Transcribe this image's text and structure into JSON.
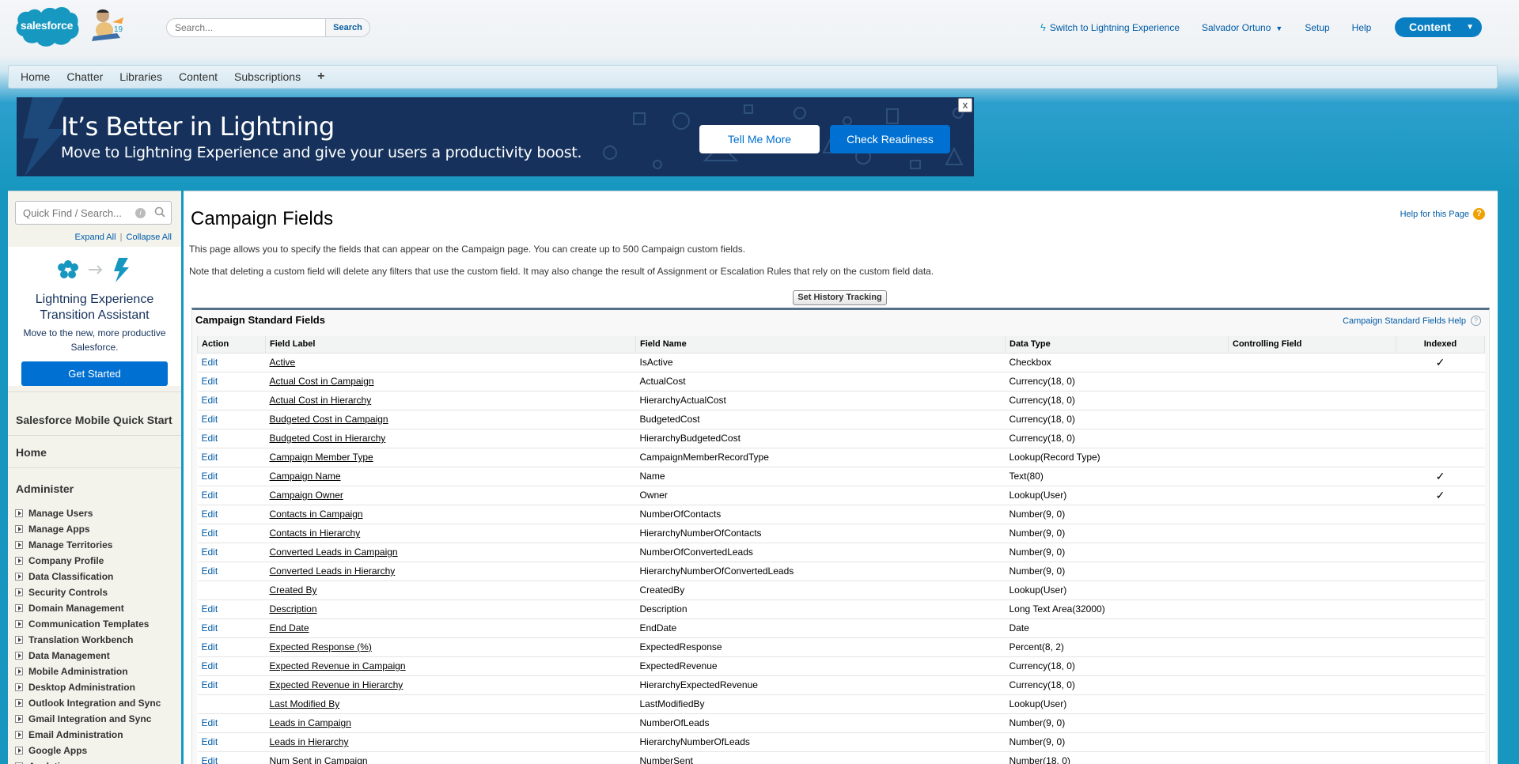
{
  "header": {
    "logo_text": "salesforce",
    "mascot_badge": "19",
    "search_placeholder": "Search...",
    "search_button": "Search",
    "switch_link": "Switch to Lightning Experience",
    "user_name": "Salvador Ortuno",
    "setup": "Setup",
    "help": "Help",
    "app_menu": "Content"
  },
  "tabs": [
    "Home",
    "Chatter",
    "Libraries",
    "Content",
    "Subscriptions"
  ],
  "tabs_plus": "+",
  "banner": {
    "title": "It’s Better in Lightning",
    "subtitle": "Move to Lightning Experience and give your users a productivity boost.",
    "tell_me_more": "Tell Me More",
    "check_readiness": "Check Readiness",
    "close": "x"
  },
  "sidebar": {
    "quick_find_placeholder": "Quick Find / Search...",
    "expand_all": "Expand All",
    "separator": "|",
    "collapse_all": "Collapse All",
    "lea_title": "Lightning Experience Transition Assistant",
    "lea_subtitle": "Move to the new, more productive Salesforce.",
    "lea_button": "Get Started",
    "mobile_quick_start": "Salesforce Mobile Quick Start",
    "home": "Home",
    "administer": "Administer",
    "items": [
      "Manage Users",
      "Manage Apps",
      "Manage Territories",
      "Company Profile",
      "Data Classification",
      "Security Controls",
      "Domain Management",
      "Communication Templates",
      "Translation Workbench",
      "Data Management",
      "Mobile Administration",
      "Desktop Administration",
      "Outlook Integration and Sync",
      "Gmail Integration and Sync",
      "Email Administration",
      "Google Apps",
      "Analytics"
    ]
  },
  "main": {
    "title": "Campaign Fields",
    "help_for_page": "Help for this Page",
    "description_1": "This page allows you to specify the fields that can appear on the Campaign page. You can create up to 500 Campaign custom fields.",
    "description_2": "Note that deleting a custom field will delete any filters that use the custom field. It may also change the result of Assignment or Escalation Rules that rely on the custom field data.",
    "history_button": "Set History Tracking",
    "panel_title": "Campaign Standard Fields",
    "panel_help": "Campaign Standard Fields Help",
    "columns": [
      "Action",
      "Field Label",
      "Field Name",
      "Data Type",
      "Controlling Field",
      "Indexed"
    ],
    "rows": [
      {
        "action": "Edit",
        "label": "Active",
        "name": "IsActive",
        "type": "Checkbox",
        "controlling": "",
        "indexed": "✓"
      },
      {
        "action": "Edit",
        "label": "Actual Cost in Campaign",
        "name": "ActualCost",
        "type": "Currency(18, 0)",
        "controlling": "",
        "indexed": ""
      },
      {
        "action": "Edit",
        "label": "Actual Cost in Hierarchy",
        "name": "HierarchyActualCost",
        "type": "Currency(18, 0)",
        "controlling": "",
        "indexed": ""
      },
      {
        "action": "Edit",
        "label": "Budgeted Cost in Campaign",
        "name": "BudgetedCost",
        "type": "Currency(18, 0)",
        "controlling": "",
        "indexed": ""
      },
      {
        "action": "Edit",
        "label": "Budgeted Cost in Hierarchy",
        "name": "HierarchyBudgetedCost",
        "type": "Currency(18, 0)",
        "controlling": "",
        "indexed": ""
      },
      {
        "action": "Edit",
        "label": "Campaign Member Type",
        "name": "CampaignMemberRecordType",
        "type": "Lookup(Record Type)",
        "controlling": "",
        "indexed": ""
      },
      {
        "action": "Edit",
        "label": "Campaign Name",
        "name": "Name",
        "type": "Text(80)",
        "controlling": "",
        "indexed": "✓"
      },
      {
        "action": "Edit",
        "label": "Campaign Owner",
        "name": "Owner",
        "type": "Lookup(User)",
        "controlling": "",
        "indexed": "✓"
      },
      {
        "action": "Edit",
        "label": "Contacts in Campaign",
        "name": "NumberOfContacts",
        "type": "Number(9, 0)",
        "controlling": "",
        "indexed": ""
      },
      {
        "action": "Edit",
        "label": "Contacts in Hierarchy",
        "name": "HierarchyNumberOfContacts",
        "type": "Number(9, 0)",
        "controlling": "",
        "indexed": ""
      },
      {
        "action": "Edit",
        "label": "Converted Leads in Campaign",
        "name": "NumberOfConvertedLeads",
        "type": "Number(9, 0)",
        "controlling": "",
        "indexed": ""
      },
      {
        "action": "Edit",
        "label": "Converted Leads in Hierarchy",
        "name": "HierarchyNumberOfConvertedLeads",
        "type": "Number(9, 0)",
        "controlling": "",
        "indexed": ""
      },
      {
        "action": "",
        "label": "Created By",
        "name": "CreatedBy",
        "type": "Lookup(User)",
        "controlling": "",
        "indexed": ""
      },
      {
        "action": "Edit",
        "label": "Description",
        "name": "Description",
        "type": "Long Text Area(32000)",
        "controlling": "",
        "indexed": ""
      },
      {
        "action": "Edit",
        "label": "End Date",
        "name": "EndDate",
        "type": "Date",
        "controlling": "",
        "indexed": ""
      },
      {
        "action": "Edit",
        "label": "Expected Response (%)",
        "name": "ExpectedResponse",
        "type": "Percent(8, 2)",
        "controlling": "",
        "indexed": ""
      },
      {
        "action": "Edit",
        "label": "Expected Revenue in Campaign",
        "name": "ExpectedRevenue",
        "type": "Currency(18, 0)",
        "controlling": "",
        "indexed": ""
      },
      {
        "action": "Edit",
        "label": "Expected Revenue in Hierarchy",
        "name": "HierarchyExpectedRevenue",
        "type": "Currency(18, 0)",
        "controlling": "",
        "indexed": ""
      },
      {
        "action": "",
        "label": "Last Modified By",
        "name": "LastModifiedBy",
        "type": "Lookup(User)",
        "controlling": "",
        "indexed": ""
      },
      {
        "action": "Edit",
        "label": "Leads in Campaign",
        "name": "NumberOfLeads",
        "type": "Number(9, 0)",
        "controlling": "",
        "indexed": ""
      },
      {
        "action": "Edit",
        "label": "Leads in Hierarchy",
        "name": "HierarchyNumberOfLeads",
        "type": "Number(9, 0)",
        "controlling": "",
        "indexed": ""
      },
      {
        "action": "Edit",
        "label": "Num Sent in Campaign",
        "name": "NumberSent",
        "type": "Number(18, 0)",
        "controlling": "",
        "indexed": ""
      }
    ]
  },
  "colors": {
    "link": "#015ba7",
    "brand_blue": "#1797c0",
    "banner_bg": "#16325c",
    "primary_button": "#0070d2",
    "panel_border": "#56708a"
  },
  "icons": [
    "salesforce-logo",
    "mascot-icon",
    "bolt-icon",
    "caret-down-icon",
    "close-icon",
    "info-icon",
    "magnifier-icon",
    "help-icon",
    "expand-arrow-icon",
    "checkmark-icon"
  ]
}
